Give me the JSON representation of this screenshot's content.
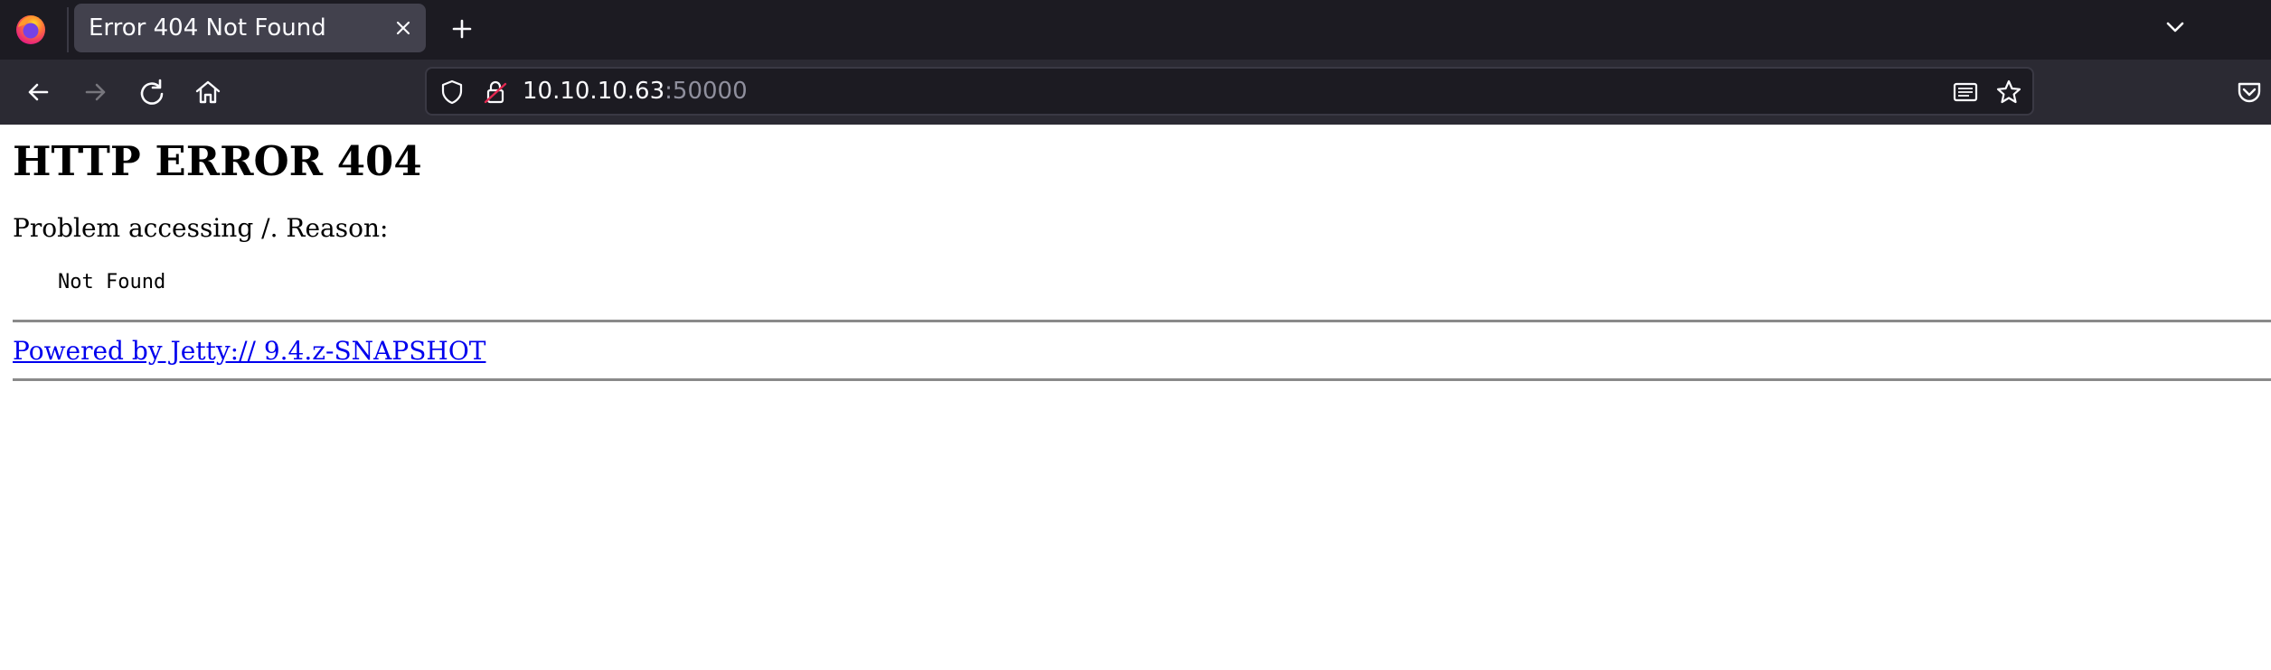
{
  "browser": {
    "tab": {
      "title": "Error 404 Not Found"
    },
    "url": {
      "host": "10.10.10.63",
      "port": ":50000"
    },
    "icons": {
      "app_logo": "firefox-logo-icon",
      "tab_close": "close-icon",
      "new_tab": "plus-icon",
      "list_tabs": "chevron-down-icon",
      "back": "arrow-left-icon",
      "forward": "arrow-right-icon",
      "reload": "reload-icon",
      "home": "home-icon",
      "tracking_protection": "shield-icon",
      "connection_insecure": "lock-warning-icon",
      "reader_view": "reader-view-icon",
      "bookmark": "star-icon",
      "pocket": "pocket-icon"
    },
    "colors": {
      "tabstrip_bg": "#1c1b22",
      "active_tab_bg": "#42414d",
      "navbar_bg": "#2b2a33",
      "urlbar_bg": "#1c1b22",
      "insecure_accent": "#e22850"
    }
  },
  "page": {
    "heading": "HTTP ERROR 404",
    "problem_text": "Problem accessing /. Reason:",
    "reason": "Not Found",
    "footer_link": "Powered by Jetty:// 9.4.z-SNAPSHOT",
    "colors": {
      "link": "#0000ee",
      "text": "#000000",
      "background": "#ffffff"
    }
  }
}
